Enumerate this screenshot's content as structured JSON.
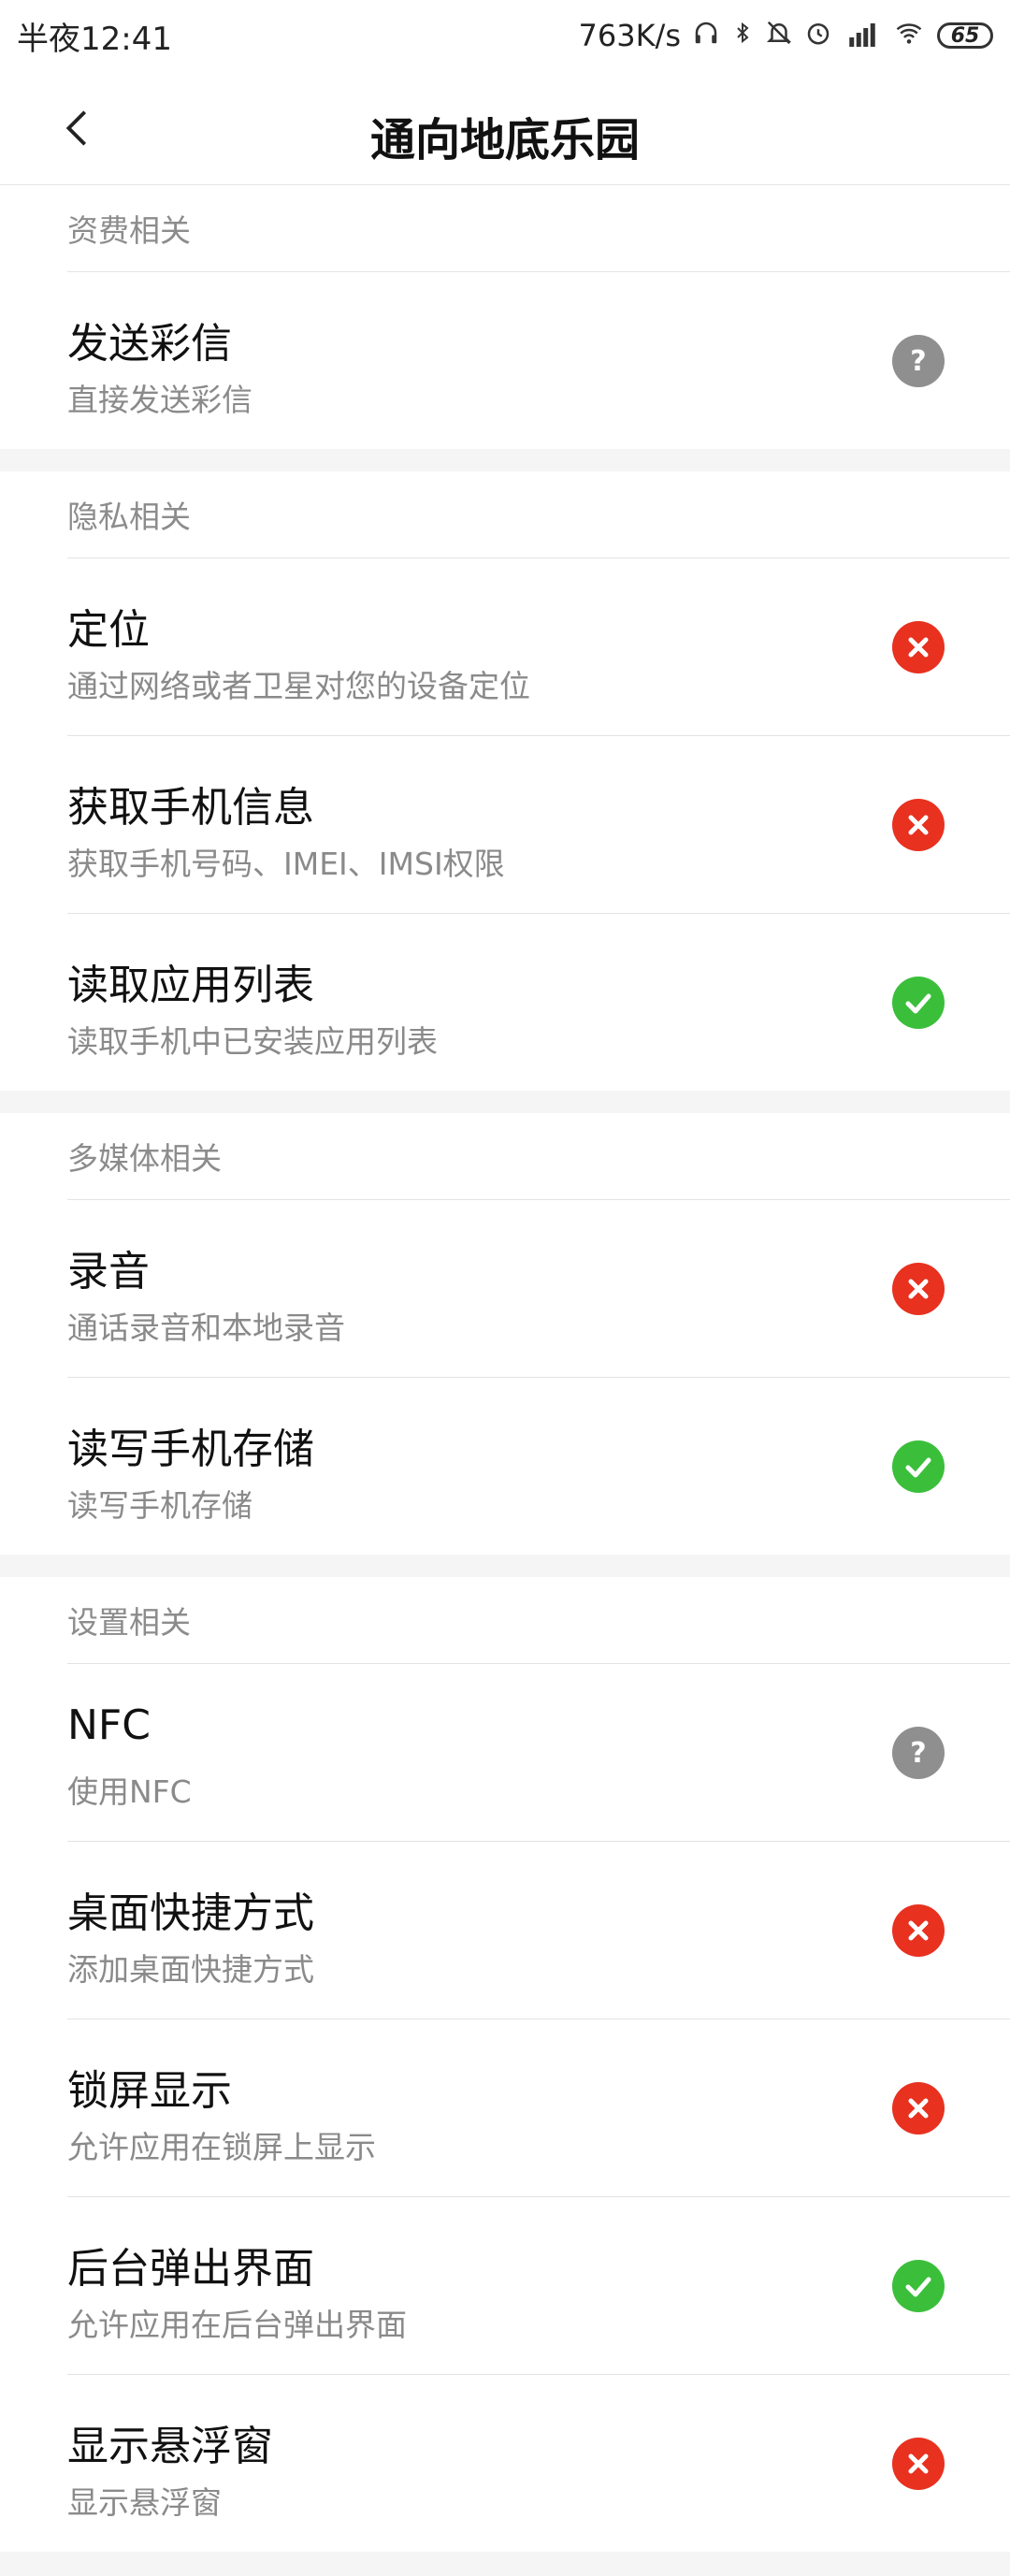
{
  "statusbar": {
    "time": "半夜12:41",
    "speed": "763K/s",
    "battery": "65"
  },
  "header": {
    "title": "通向地底乐园"
  },
  "sections": [
    {
      "title": "资费相关",
      "items": [
        {
          "title": "发送彩信",
          "subtitle": "直接发送彩信",
          "status": "ask"
        }
      ]
    },
    {
      "title": "隐私相关",
      "items": [
        {
          "title": "定位",
          "subtitle": "通过网络或者卫星对您的设备定位",
          "status": "deny"
        },
        {
          "title": "获取手机信息",
          "subtitle": "获取手机号码、IMEI、IMSI权限",
          "status": "deny"
        },
        {
          "title": "读取应用列表",
          "subtitle": "读取手机中已安装应用列表",
          "status": "allow"
        }
      ]
    },
    {
      "title": "多媒体相关",
      "items": [
        {
          "title": "录音",
          "subtitle": "通话录音和本地录音",
          "status": "deny"
        },
        {
          "title": "读写手机存储",
          "subtitle": "读写手机存储",
          "status": "allow"
        }
      ]
    },
    {
      "title": "设置相关",
      "items": [
        {
          "title": "NFC",
          "subtitle": "使用NFC",
          "status": "ask"
        },
        {
          "title": "桌面快捷方式",
          "subtitle": "添加桌面快捷方式",
          "status": "deny"
        },
        {
          "title": "锁屏显示",
          "subtitle": "允许应用在锁屏上显示",
          "status": "deny"
        },
        {
          "title": "后台弹出界面",
          "subtitle": "允许应用在后台弹出界面",
          "status": "allow"
        },
        {
          "title": "显示悬浮窗",
          "subtitle": "显示悬浮窗",
          "status": "deny"
        }
      ]
    }
  ],
  "colors": {
    "deny": "#e8311f",
    "allow": "#3bbf3b",
    "ask": "#8f8f8f"
  },
  "icons": {
    "deny": "deny-x-icon",
    "allow": "allow-check-icon",
    "ask": "ask-question-icon"
  }
}
